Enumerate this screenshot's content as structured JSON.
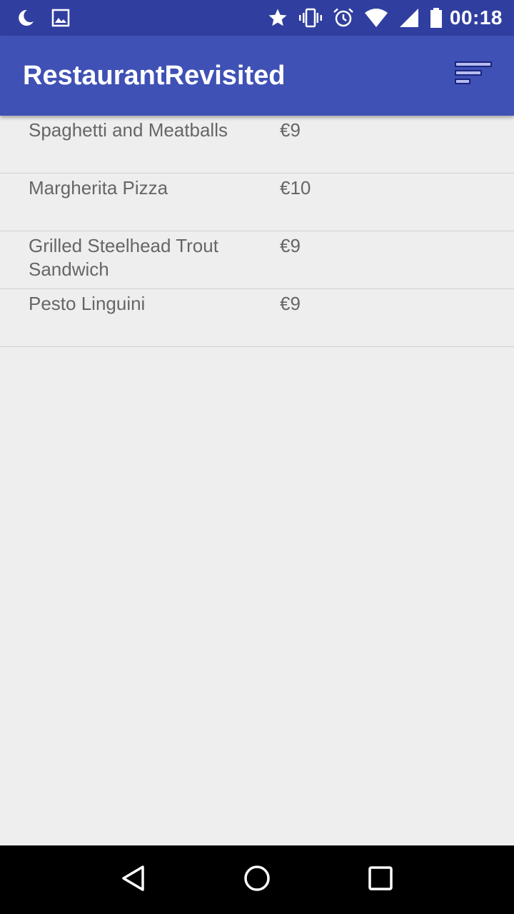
{
  "status_bar": {
    "time": "00:18",
    "icons": [
      "moon-icon",
      "image-icon",
      "star-icon",
      "vibrate-icon",
      "alarm-icon",
      "wifi-icon",
      "signal-icon",
      "battery-icon"
    ]
  },
  "app_bar": {
    "title": "RestaurantRevisited",
    "action_icon": "sort-icon"
  },
  "menu": {
    "items": [
      {
        "name": "Spaghetti and Meatballs",
        "price": "€9"
      },
      {
        "name": "Margherita Pizza",
        "price": "€10"
      },
      {
        "name": "Grilled Steelhead Trout Sandwich",
        "price": "€9"
      },
      {
        "name": "Pesto Linguini",
        "price": "€9"
      }
    ]
  },
  "nav_bar": {
    "buttons": [
      "back-icon",
      "home-icon",
      "recents-icon"
    ]
  },
  "colors": {
    "status_bar": "#303f9f",
    "app_bar": "#3f51b5",
    "background": "#eeeeee",
    "text": "#666666"
  }
}
